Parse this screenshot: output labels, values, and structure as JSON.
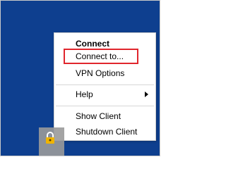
{
  "menu": {
    "items": [
      {
        "label": "Connect"
      },
      {
        "label": "Connect to..."
      },
      {
        "label": "VPN Options"
      },
      {
        "label": "Help"
      },
      {
        "label": "Show Client"
      },
      {
        "label": "Shutdown Client"
      }
    ]
  },
  "tray": {
    "icon": "vpn-lock-icon"
  },
  "colors": {
    "desktop": "#0e3f8f",
    "highlight_box": "#e0262d",
    "menu_background": "#ffffff",
    "taskbar_tile": "#9a9a9a",
    "lock_body": "#f0b400"
  }
}
